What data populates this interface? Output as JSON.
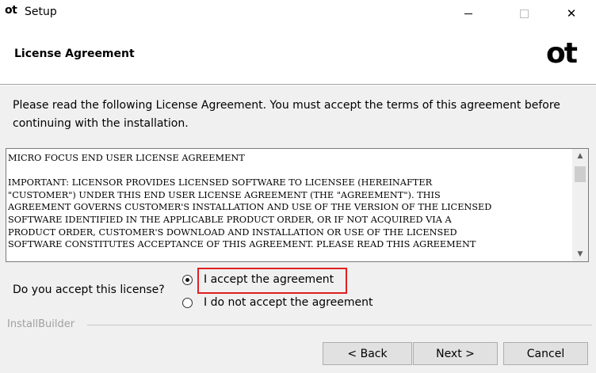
{
  "window": {
    "app_icon_text": "ot",
    "title": "Setup",
    "minimize_icon": "minimize-icon",
    "maximize_icon": "maximize-icon",
    "close_symbol": "✕"
  },
  "header": {
    "title": "License Agreement",
    "brand_logo": "ot"
  },
  "intro_text": "Please read the following License Agreement. You must accept the terms of this agreement before continuing with the installation.",
  "license": {
    "text": "MICRO FOCUS END USER LICENSE AGREEMENT\n\nIMPORTANT: LICENSOR PROVIDES LICENSED SOFTWARE TO LICENSEE (HEREINAFTER\n\"CUSTOMER\") UNDER THIS END USER LICENSE AGREEMENT (THE \"AGREEMENT\"). THIS\nAGREEMENT GOVERNS CUSTOMER'S INSTALLATION AND USE OF THE VERSION OF THE LICENSED\nSOFTWARE IDENTIFIED IN THE APPLICABLE PRODUCT ORDER, OR IF NOT ACQUIRED VIA A\nPRODUCT ORDER, CUSTOMER'S DOWNLOAD AND INSTALLATION OR USE OF THE LICENSED\nSOFTWARE CONSTITUTES ACCEPTANCE OF THIS AGREEMENT. PLEASE READ THIS AGREEMENT",
    "scroll_up_symbol": "▲",
    "scroll_down_symbol": "▼"
  },
  "accept": {
    "question": "Do you accept this license?",
    "options": [
      {
        "label": "I accept the agreement",
        "selected": true
      },
      {
        "label": "I do not accept the agreement",
        "selected": false
      }
    ]
  },
  "footer": {
    "brand": "InstallBuilder",
    "back_label": "< Back",
    "next_label": "Next >",
    "cancel_label": "Cancel"
  },
  "colors": {
    "highlight_border": "#e02020",
    "dialog_background": "#f0f0f0"
  }
}
